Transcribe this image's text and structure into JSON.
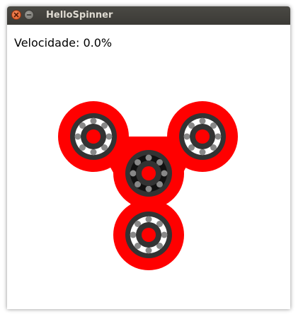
{
  "window": {
    "title": "HelloSpinner"
  },
  "status": {
    "speed_text": "Velocidade: 0.0%"
  },
  "colors": {
    "spinner_body": "#ff0000",
    "bearing_ring": "#333333",
    "bearing_balls": "#888888",
    "bearing_race_outer": "#ffffff",
    "center_race": "#111111",
    "cap": "#ff0000"
  },
  "icons": {
    "close": "close-icon",
    "minimize": "minimize-icon"
  }
}
